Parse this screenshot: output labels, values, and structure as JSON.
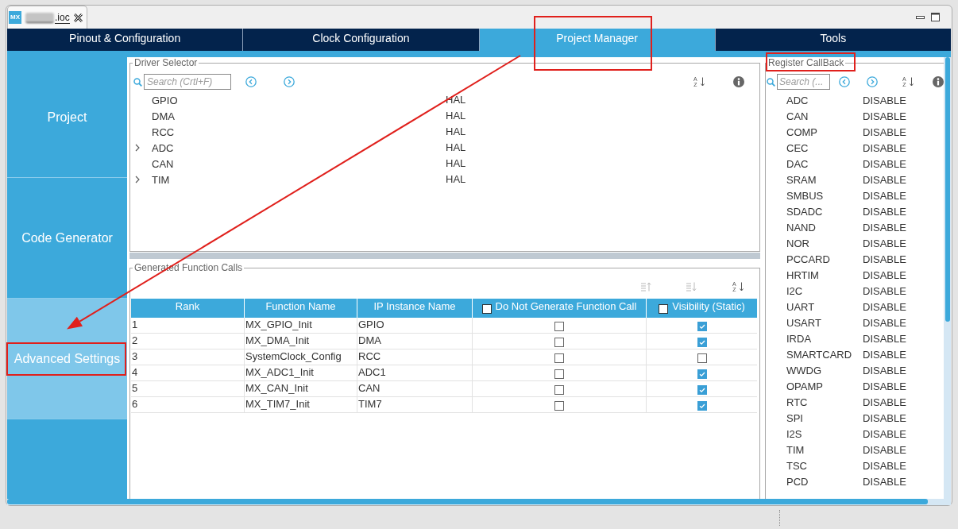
{
  "editor_tab": {
    "logo": "MX",
    "name_blurred": true,
    "title": ".ioc"
  },
  "tabs": [
    {
      "label": "Pinout & Configuration",
      "selected": false,
      "highlighted": false
    },
    {
      "label": "Clock Configuration",
      "selected": false,
      "highlighted": false
    },
    {
      "label": "Project Manager",
      "selected": true,
      "highlighted": true
    },
    {
      "label": "Tools",
      "selected": false,
      "highlighted": false
    }
  ],
  "sidebar": {
    "items": [
      {
        "label": "Project",
        "selected": false,
        "highlighted": false
      },
      {
        "label": "Code Generator",
        "selected": false,
        "highlighted": false
      },
      {
        "label": "Advanced Settings",
        "selected": true,
        "highlighted": true
      }
    ]
  },
  "driver_selector": {
    "title": "Driver Selector",
    "search": {
      "placeholder": "Search (Crtl+F)"
    },
    "sort_letters": [
      "A",
      "Z"
    ],
    "items": [
      {
        "kind": "leaf",
        "name": "GPIO",
        "value": "HAL"
      },
      {
        "kind": "leaf",
        "name": "DMA",
        "value": "HAL"
      },
      {
        "kind": "leaf",
        "name": "RCC",
        "value": "HAL"
      },
      {
        "kind": "group",
        "expanded": false,
        "name": "ADC",
        "value": "HAL"
      },
      {
        "kind": "leaf",
        "name": "CAN",
        "value": "HAL"
      },
      {
        "kind": "group",
        "expanded": false,
        "name": "TIM",
        "value": "HAL"
      }
    ]
  },
  "generated_function_calls": {
    "title": "Generated Function Calls",
    "tools": [
      {
        "kind": "sort-up",
        "disabled": true
      },
      {
        "kind": "sort-down",
        "disabled": true
      },
      {
        "kind": "sort-az",
        "disabled": false,
        "letters": [
          "A",
          "Z"
        ]
      }
    ],
    "columns": [
      {
        "kind": "text",
        "label": "Rank"
      },
      {
        "kind": "text",
        "label": "Function Name"
      },
      {
        "kind": "text",
        "label": "IP Instance Name"
      },
      {
        "kind": "check",
        "label": "Do Not Generate Function Call",
        "checked": false
      },
      {
        "kind": "check",
        "label": "Visibility (Static)",
        "checked": false
      }
    ],
    "rows": [
      {
        "rank": "1",
        "function_name": "MX_GPIO_Init",
        "ip_instance": "GPIO",
        "do_not_generate": false,
        "visibility": true
      },
      {
        "rank": "2",
        "function_name": "MX_DMA_Init",
        "ip_instance": "DMA",
        "do_not_generate": false,
        "visibility": true
      },
      {
        "rank": "3",
        "function_name": "SystemClock_Config",
        "ip_instance": "RCC",
        "do_not_generate": false,
        "visibility": false
      },
      {
        "rank": "4",
        "function_name": "MX_ADC1_Init",
        "ip_instance": "ADC1",
        "do_not_generate": false,
        "visibility": true
      },
      {
        "rank": "5",
        "function_name": "MX_CAN_Init",
        "ip_instance": "CAN",
        "do_not_generate": false,
        "visibility": true
      },
      {
        "rank": "6",
        "function_name": "MX_TIM7_Init",
        "ip_instance": "TIM7",
        "do_not_generate": false,
        "visibility": true
      }
    ]
  },
  "register_callback": {
    "title": "Register CallBack",
    "highlighted": true,
    "search": {
      "placeholder": "Search (..."
    },
    "sort_letters": [
      "A",
      "Z"
    ],
    "items": [
      {
        "name": "ADC",
        "value": "DISABLE"
      },
      {
        "name": "CAN",
        "value": "DISABLE"
      },
      {
        "name": "COMP",
        "value": "DISABLE"
      },
      {
        "name": "CEC",
        "value": "DISABLE"
      },
      {
        "name": "DAC",
        "value": "DISABLE"
      },
      {
        "name": "SRAM",
        "value": "DISABLE"
      },
      {
        "name": "SMBUS",
        "value": "DISABLE"
      },
      {
        "name": "SDADC",
        "value": "DISABLE"
      },
      {
        "name": "NAND",
        "value": "DISABLE"
      },
      {
        "name": "NOR",
        "value": "DISABLE"
      },
      {
        "name": "PCCARD",
        "value": "DISABLE"
      },
      {
        "name": "HRTIM",
        "value": "DISABLE"
      },
      {
        "name": "I2C",
        "value": "DISABLE"
      },
      {
        "name": "UART",
        "value": "DISABLE"
      },
      {
        "name": "USART",
        "value": "DISABLE"
      },
      {
        "name": "IRDA",
        "value": "DISABLE"
      },
      {
        "name": "SMARTCARD",
        "value": "DISABLE"
      },
      {
        "name": "WWDG",
        "value": "DISABLE"
      },
      {
        "name": "OPAMP",
        "value": "DISABLE"
      },
      {
        "name": "RTC",
        "value": "DISABLE"
      },
      {
        "name": "SPI",
        "value": "DISABLE"
      },
      {
        "name": "I2S",
        "value": "DISABLE"
      },
      {
        "name": "TIM",
        "value": "DISABLE"
      },
      {
        "name": "TSC",
        "value": "DISABLE"
      },
      {
        "name": "PCD",
        "value": "DISABLE"
      }
    ]
  },
  "annotation_arrow": true
}
